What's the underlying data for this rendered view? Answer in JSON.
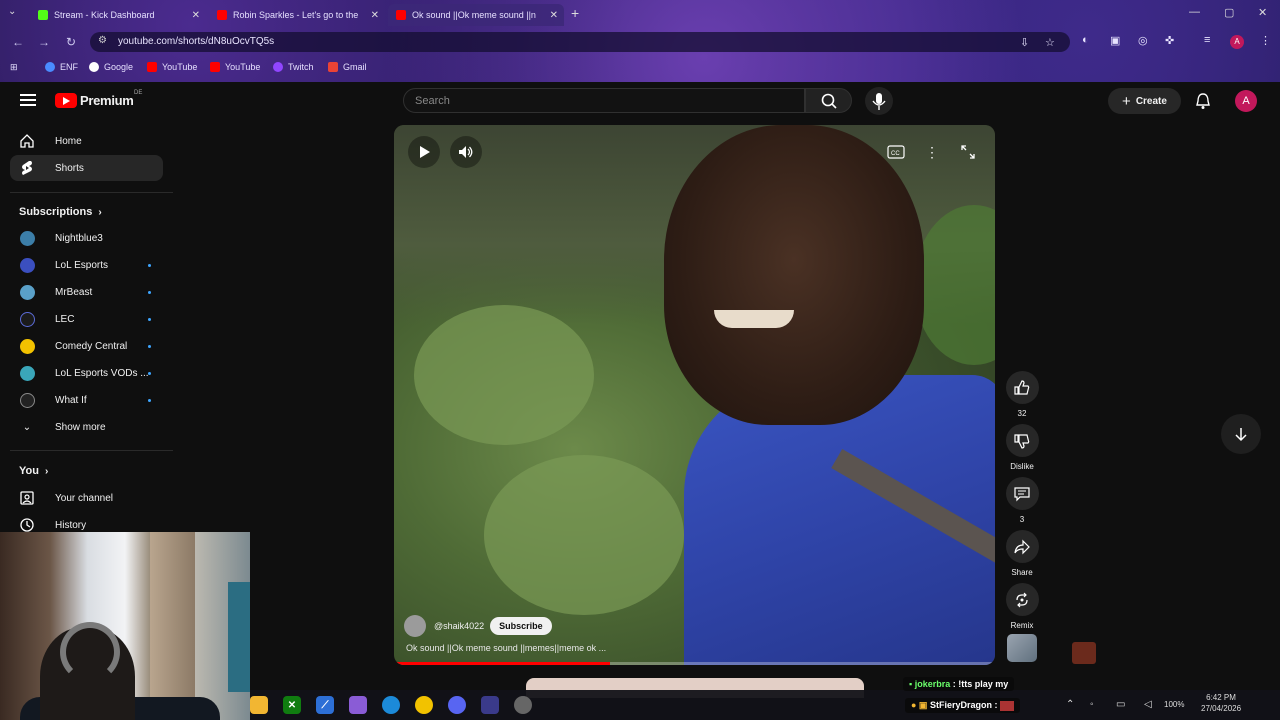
{
  "browser": {
    "tabs": [
      {
        "title": "Stream - Kick Dashboard",
        "favicon_color": "#53fc18",
        "active": false
      },
      {
        "title": "Robin Sparkles - Let's go to the",
        "favicon_color": "#ff0000",
        "active": false
      },
      {
        "title": "Ok sound ||Ok meme sound ||n",
        "favicon_color": "#ff0000",
        "active": true
      }
    ],
    "url": "youtube.com/shorts/dN8uOcvTQ5s",
    "bookmarks": [
      {
        "label": "ENF",
        "icon": "globe-icon",
        "color": "#4a8cff"
      },
      {
        "label": "Google",
        "icon": "google-icon",
        "color": "#ffffff"
      },
      {
        "label": "YouTube",
        "icon": "youtube-icon",
        "color": "#ff0000"
      },
      {
        "label": "YouTube",
        "icon": "youtube-icon",
        "color": "#ff0000"
      },
      {
        "label": "Twitch",
        "icon": "twitch-icon",
        "color": "#9146ff"
      },
      {
        "label": "Gmail",
        "icon": "gmail-icon",
        "color": "#ea4335"
      }
    ],
    "profile_initial": "A"
  },
  "youtube": {
    "logo_text": "Premium",
    "country_code": "DE",
    "search_placeholder": "Search",
    "create_label": "Create",
    "avatar_initial": "A"
  },
  "sidebar": {
    "primary": [
      {
        "label": "Home",
        "icon": "home-icon",
        "active": false
      },
      {
        "label": "Shorts",
        "icon": "shorts-icon",
        "active": true
      }
    ],
    "subscriptions_heading": "Subscriptions",
    "subscriptions": [
      {
        "label": "Nightblue3",
        "color": "#3c7ea8",
        "new": false
      },
      {
        "label": "LoL Esports",
        "color": "#3b4fbf",
        "new": true
      },
      {
        "label": "MrBeast",
        "color": "#5aa0c8",
        "new": true
      },
      {
        "label": "LEC",
        "color": "#1b1b1b",
        "new": true
      },
      {
        "label": "Comedy Central",
        "color": "#f2c200",
        "new": true
      },
      {
        "label": "LoL Esports VODs ...",
        "color": "#3aa6b9",
        "new": true
      },
      {
        "label": "What If",
        "color": "#222222",
        "new": true
      }
    ],
    "show_more": "Show more",
    "you_heading": "You",
    "you_items": [
      {
        "label": "Your channel",
        "icon": "channel-icon"
      },
      {
        "label": "History",
        "icon": "history-icon"
      }
    ]
  },
  "video": {
    "channel": "@shaik4022",
    "subscribe_label": "Subscribe",
    "title": "Ok sound ||Ok meme sound ||memes||meme ok ...",
    "progress_fraction": 0.36
  },
  "actions": [
    {
      "name": "like",
      "icon": "thumbs-up-icon",
      "label": "32"
    },
    {
      "name": "dislike",
      "icon": "thumbs-down-icon",
      "label": "Dislike"
    },
    {
      "name": "comments",
      "icon": "comment-icon",
      "label": "3"
    },
    {
      "name": "share",
      "icon": "share-icon",
      "label": "Share"
    },
    {
      "name": "remix",
      "icon": "remix-icon",
      "label": "Remix"
    }
  ],
  "chat": [
    {
      "name": "jokerbra",
      "message": "!tts play my"
    },
    {
      "name": "StFieryDragon",
      "message": ""
    }
  ],
  "taskbar": {
    "battery": "100%",
    "time": "6:42 PM",
    "date": "27/04/2026"
  }
}
